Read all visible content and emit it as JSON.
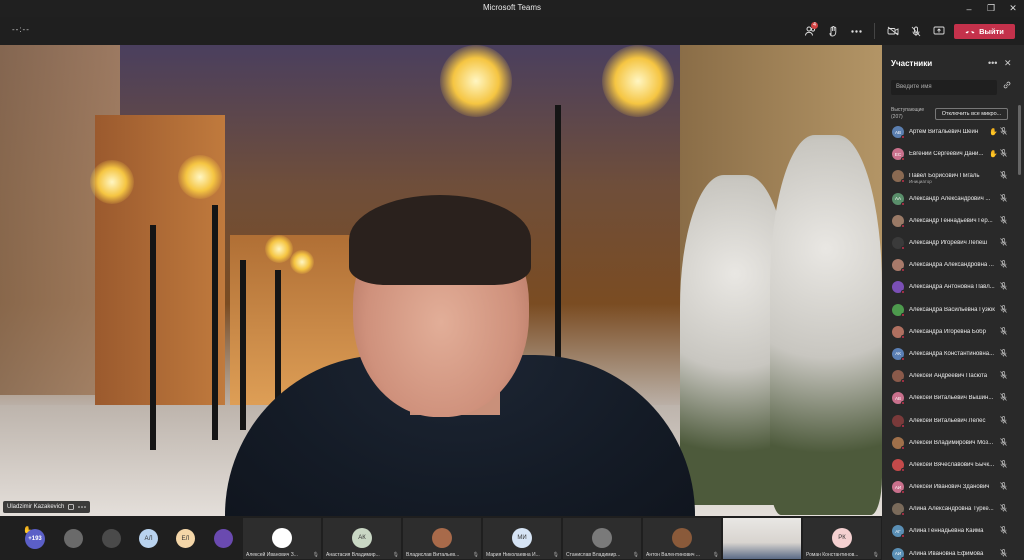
{
  "window": {
    "title": "Microsoft Teams",
    "minimize": "–",
    "restore": "❐",
    "close": "✕"
  },
  "toolbar": {
    "timer": "--:--",
    "chat_badge": "4",
    "leave_label": "Выйти",
    "icons": [
      "participants-icon",
      "raise-hand-icon",
      "more-icon",
      "camera-off-icon",
      "mic-off-icon",
      "share-screen-icon",
      "leave-phone-icon"
    ]
  },
  "video": {
    "speaker_name": "Uladzimir Kazakevich"
  },
  "panel": {
    "title": "Участники",
    "search_placeholder": "Введите имя",
    "speakers_label": "Выступающие (207)",
    "mute_all_label": "Отключить все микро...",
    "participants": [
      {
        "name": "Артем Витальевич Шеин",
        "initials": "АВ",
        "color": "#5b7fb0",
        "hand": true
      },
      {
        "name": "Евгений Сергеевич Дани...",
        "initials": "ЕС",
        "color": "#c9708c",
        "hand": true
      },
      {
        "name": "Павел Борисович Пигаль",
        "initials": "",
        "color": "#8a6a52",
        "subtitle": "Инициатор"
      },
      {
        "name": "Александр Александрович ...",
        "initials": "АА",
        "color": "#5a8f6b"
      },
      {
        "name": "Александр Геннадьевич Гер...",
        "initials": "",
        "color": "#9a7a66"
      },
      {
        "name": "Александр Игоревич Лепеш",
        "initials": "",
        "color": "#3a3a3a"
      },
      {
        "name": "Александра Александровна ...",
        "initials": "",
        "color": "#a87a6a"
      },
      {
        "name": "Александра Антоновна Павл...",
        "initials": "",
        "color": "#7a4fb5"
      },
      {
        "name": "Александра Васильевна Гузюк",
        "initials": "",
        "color": "#4d9a4d"
      },
      {
        "name": "Александра Игоревна Бобр",
        "initials": "",
        "color": "#b07060"
      },
      {
        "name": "Александра Константиновна...",
        "initials": "АК",
        "color": "#5a7fb5"
      },
      {
        "name": "Алексей Андреевич Пасюта",
        "initials": "",
        "color": "#8a5a4a"
      },
      {
        "name": "Алексей Витальевич Вышин...",
        "initials": "АВ",
        "color": "#c9708c"
      },
      {
        "name": "Алексей Витальевич Лелес",
        "initials": "",
        "color": "#7a3a3a"
      },
      {
        "name": "Алексей Владимирович Моз...",
        "initials": "",
        "color": "#a0704a"
      },
      {
        "name": "Алексей Вячеславович Бычк...",
        "initials": "",
        "color": "#c44a4a"
      },
      {
        "name": "Алексей Иванович Зданович",
        "initials": "АИ",
        "color": "#c9708c"
      },
      {
        "name": "Алина Александровна Турке...",
        "initials": "",
        "color": "#7a6a5a"
      },
      {
        "name": "Алина Геннадьевна Кайма",
        "initials": "АГ",
        "color": "#5a8fb5"
      },
      {
        "name": "Алина Ивановна Ефимова",
        "initials": "АИ",
        "color": "#5a8fb5"
      }
    ]
  },
  "strip": {
    "more_count": "+193",
    "small_avatars": [
      {
        "initials": "",
        "color": "#6a6a6a"
      },
      {
        "initials": "",
        "color": "#4a4a4a"
      },
      {
        "initials": "АЛ",
        "color": "#b9d3ef"
      },
      {
        "initials": "ЕЛ",
        "color": "#f4d6a8"
      },
      {
        "initials": "",
        "color": "#6a4ab0"
      }
    ],
    "tiles": [
      {
        "name": "Алексей Иванович З...",
        "initials": "",
        "color": "#ffffff"
      },
      {
        "name": "Анастасия Владимир...",
        "initials": "АК",
        "color": "#c9d7c4"
      },
      {
        "name": "Владислав Витальев...",
        "initials": "",
        "color": "#a86a4a"
      },
      {
        "name": "Мария Николаевна И...",
        "initials": "МИ",
        "color": "#d6e4f5"
      },
      {
        "name": "Станислав Владимир...",
        "initials": "",
        "color": "#7a7a7a"
      },
      {
        "name": "Антон Валентинович ...",
        "initials": "",
        "color": "#8a5a3a"
      },
      {
        "name": "",
        "initials": "",
        "color": "#d8d4cf"
      },
      {
        "name": "Роман Константинов...",
        "initials": "РК",
        "color": "#f4d0d0"
      }
    ]
  }
}
